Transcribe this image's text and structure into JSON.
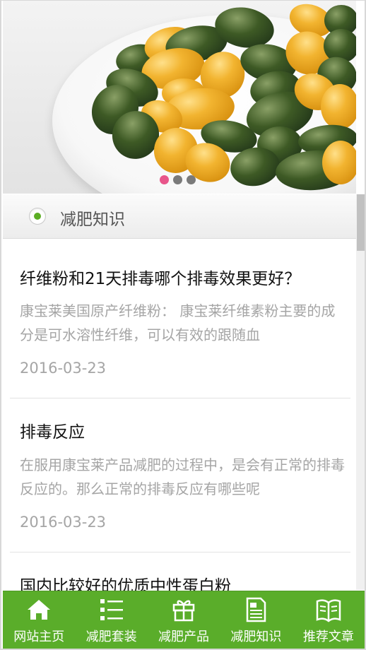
{
  "banner": {
    "slides": 3,
    "active_slide": 1
  },
  "section": {
    "title": "减肥知识"
  },
  "articles": [
    {
      "title": "纤维粉和21天排毒哪个排毒效果更好？",
      "summary": "康宝莱美国原产纤维粉： 康宝莱纤维素粉主要的成分是可水溶性纤维，可以有效的跟随血",
      "date": "2016-03-23"
    },
    {
      "title": "排毒反应",
      "summary": "在服用康宝莱产品减肥的过程中，是会有正常的排毒反应的。那么正常的排毒反应有哪些呢",
      "date": "2016-03-23"
    },
    {
      "title": "国内比较好的优质中性蛋白粉",
      "summary": "",
      "date": ""
    }
  ],
  "nav": [
    {
      "label": "网站主页",
      "icon": "home-icon"
    },
    {
      "label": "减肥套装",
      "icon": "list-icon"
    },
    {
      "label": "减肥产品",
      "icon": "gift-icon"
    },
    {
      "label": "减肥知识",
      "icon": "document-icon"
    },
    {
      "label": "推荐文章",
      "icon": "book-icon"
    }
  ],
  "colors": {
    "accent_green": "#5aad2a",
    "active_dot": "#e8558a",
    "muted_text": "#a5a5a5"
  }
}
